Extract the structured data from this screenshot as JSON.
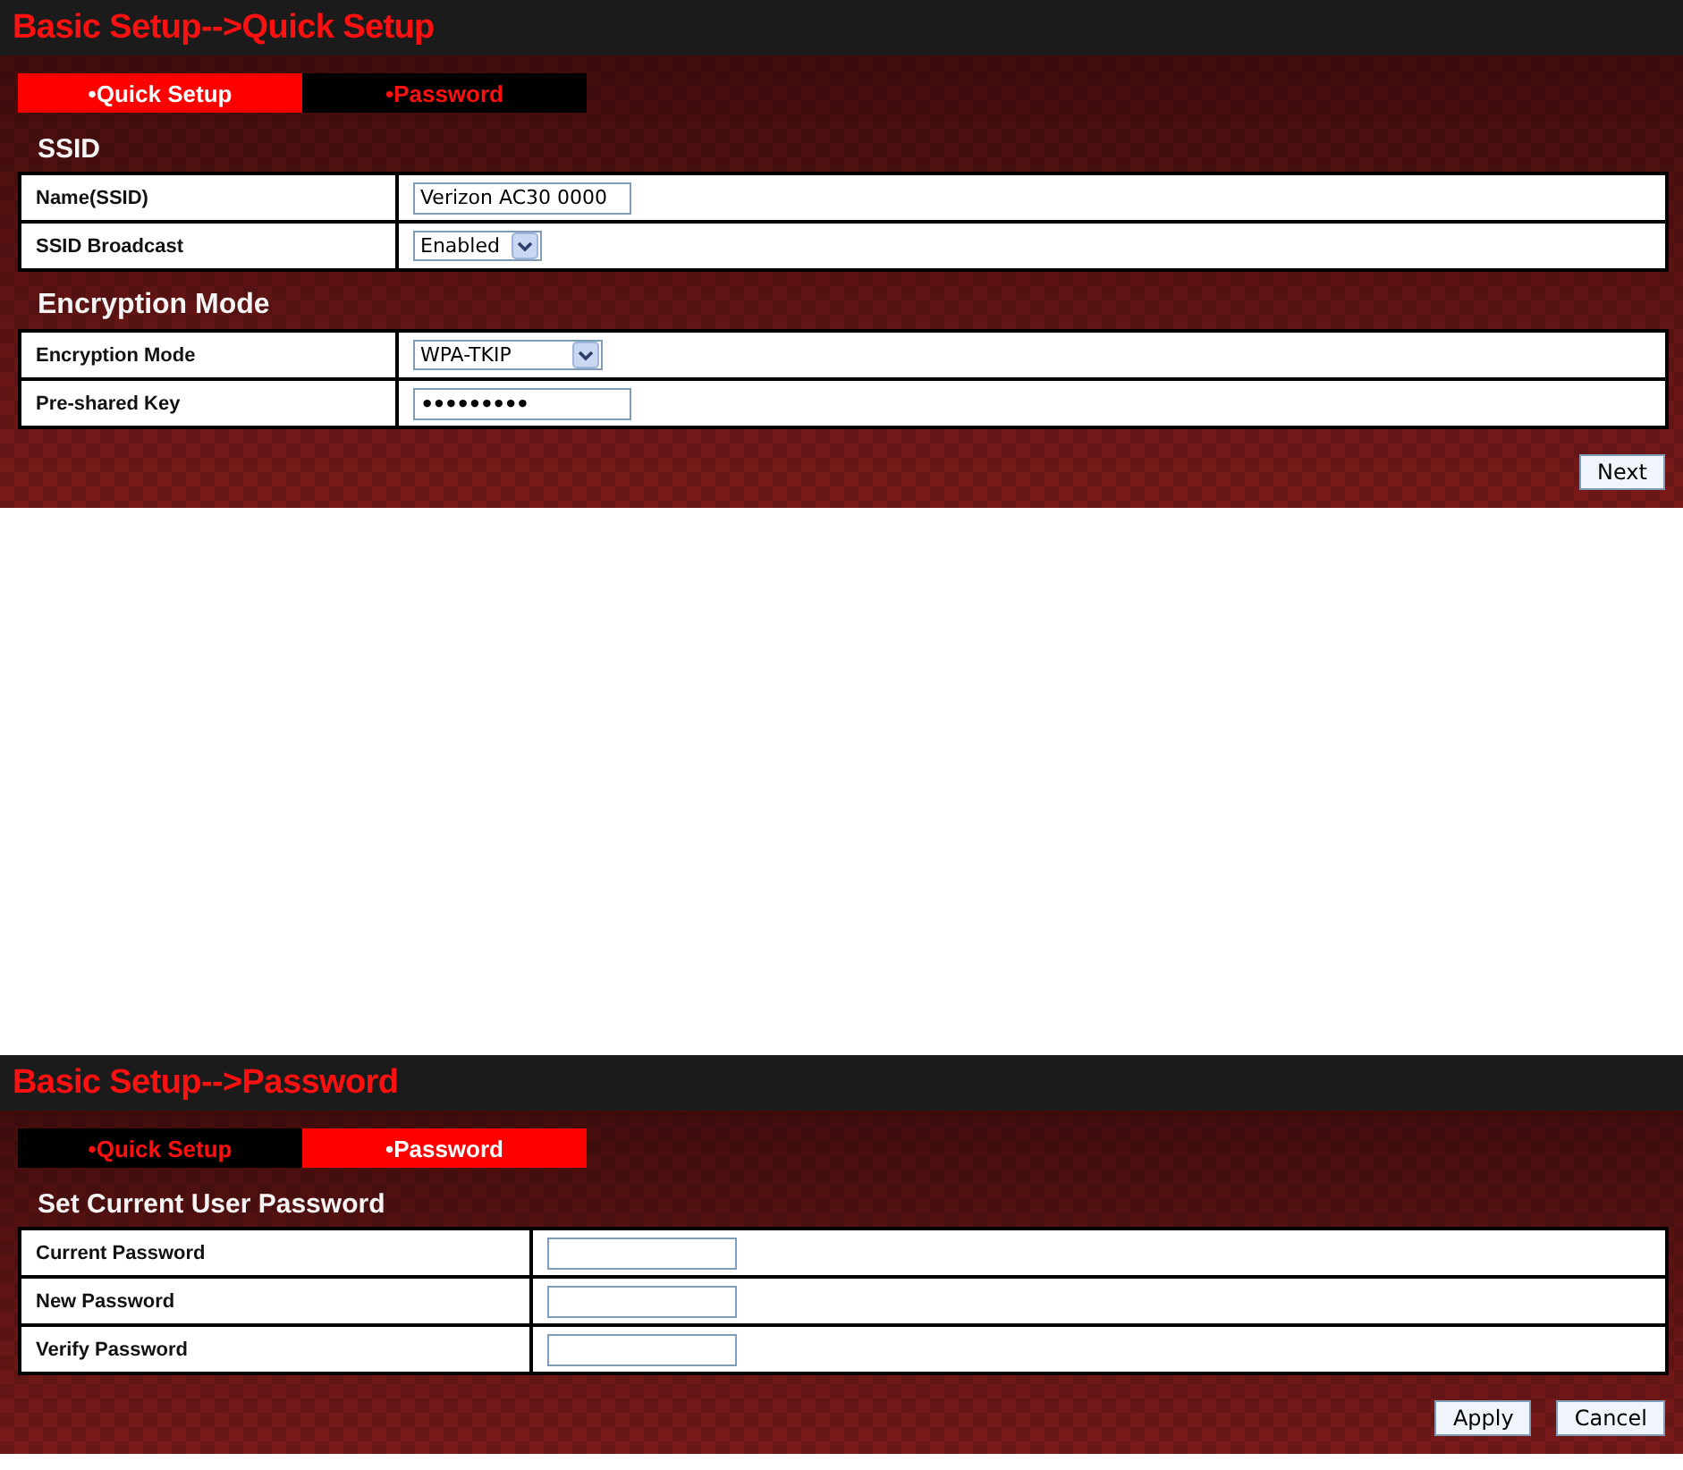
{
  "panels": [
    {
      "title": "Basic Setup-->Quick Setup",
      "tabs": [
        {
          "label": "•Quick Setup",
          "selected": true
        },
        {
          "label": "•Password",
          "selected": false
        }
      ],
      "sections": [
        {
          "heading": "SSID",
          "rows": [
            {
              "label": "Name(SSID)",
              "kind": "text",
              "value": "Verizon AC30 0000"
            },
            {
              "label": "SSID Broadcast",
              "kind": "select",
              "value": "Enabled"
            }
          ]
        },
        {
          "heading": "Encryption Mode",
          "rows": [
            {
              "label": "Encryption Mode",
              "kind": "select",
              "value": "WPA-TKIP"
            },
            {
              "label": "Pre-shared Key",
              "kind": "password",
              "value": "•••••••••"
            }
          ]
        }
      ],
      "buttons": [
        "Next"
      ]
    },
    {
      "title": "Basic Setup-->Password",
      "tabs": [
        {
          "label": "•Quick Setup",
          "selected": false
        },
        {
          "label": "•Password",
          "selected": true
        }
      ],
      "sections": [
        {
          "heading": "Set Current User Password",
          "rows": [
            {
              "label": "Current Password",
              "kind": "text",
              "value": ""
            },
            {
              "label": "New Password",
              "kind": "text",
              "value": ""
            },
            {
              "label": "Verify Password",
              "kind": "text",
              "value": ""
            }
          ]
        }
      ],
      "buttons": [
        "Apply",
        "Cancel"
      ]
    }
  ]
}
